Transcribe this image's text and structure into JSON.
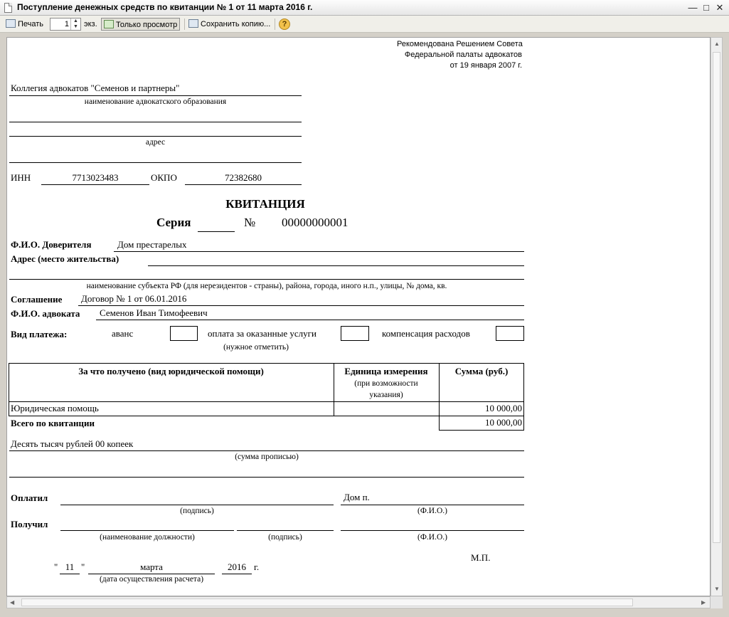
{
  "window": {
    "title": "Поступление денежных средств по квитанции № 1 от 11 марта 2016 г."
  },
  "toolbar": {
    "print_label": "Печать",
    "copies_value": "1",
    "copies_unit": "экз.",
    "view_only_label": "Только просмотр",
    "save_copy_label": "Сохранить копию...",
    "help_glyph": "?"
  },
  "document": {
    "recommend_line1": "Рекомендована Решением Совета",
    "recommend_line2": "Федеральной палаты адвокатов",
    "recommend_line3": "от 19 января 2007 г.",
    "org_name": "Коллегия адвокатов \"Семенов и партнеры\"",
    "org_caption": "наименование адвокатского образования",
    "address_caption": "адрес",
    "inn_label": "ИНН",
    "inn_value": "7713023483",
    "okpo_label": "ОКПО",
    "okpo_value": "72382680",
    "heading": "КВИТАНЦИЯ",
    "series_label": "Серия",
    "number_sign": "№",
    "number_value": "00000000001",
    "trustor_label": "Ф.И.О. Доверителя",
    "trustor_value": "Дом престарелых",
    "residence_label": "Адрес (место жительства)",
    "residence_caption": "наименование субъекта РФ (для нерезидентов - страны), района, города, иного н.п., улицы, № дома, кв.",
    "agreement_label": "Соглашение",
    "agreement_value": "Договор № 1 от 06.01.2016",
    "lawyer_label": "Ф.И.О. адвоката",
    "lawyer_value": "Семенов Иван Тимофеевич",
    "payment_type_label": "Вид платежа:",
    "opt_advance": "аванс",
    "opt_services": "оплата за оказанные услуги",
    "opt_expenses": "компенсация расходов",
    "mark_caption": "(нужное отметить)",
    "table": {
      "col1": "За что получено (вид юридической помощи)",
      "col2": "Единица измерения",
      "col2_sub1": "(при возможности",
      "col2_sub2": "указания)",
      "col3": "Сумма (руб.)",
      "rows": [
        {
          "service": "Юридическая помощь",
          "unit": "",
          "amount": "10 000,00"
        }
      ],
      "total_label": "Всего по квитанции",
      "total_value": "10 000,00"
    },
    "amount_words": "Десять тысяч рублей 00 копеек",
    "amount_words_caption": "(сумма прописью)",
    "paid_label": "Оплатил",
    "paid_name": "Дом п.",
    "signature_caption": "(подпись)",
    "fio_caption": "(Ф.И.О.)",
    "received_label": "Получил",
    "position_caption": "(наименование должности)",
    "signature_caption2": "(подпись)",
    "fio_caption2": "(Ф.И.О.)",
    "stamp": "М.П.",
    "quote_open": "\"",
    "day": "11",
    "quote_close": "\"",
    "month": "марта",
    "year": "2016",
    "year_suffix": "г.",
    "date_caption": "(дата осуществления расчета)"
  }
}
